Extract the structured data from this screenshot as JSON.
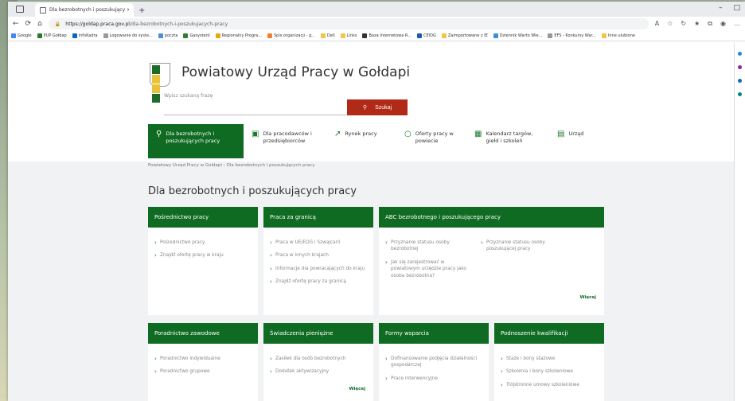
{
  "browser": {
    "tab_title": "Dla bezrobotnych i poszukujący ×",
    "url_domain": "https://goldap.praca.gov.pl",
    "url_path": "/dla-bezrobotnych-i-poszukujacych-pracy",
    "bookmarks": [
      "Google",
      "PUP Gołdap",
      "infoKadra",
      "Logowanie do syste...",
      "poczta",
      "Gasystent",
      "Regionalny Progra...",
      "Spis organizacji - g...",
      "Dell",
      "Links",
      "Baza Internetowa R...",
      "CEIDG",
      "Zaimportowane z IE",
      "Dziennik Warto Wie...",
      "EFS - Konkursy War...",
      "Inne ulubione"
    ]
  },
  "header": {
    "site_title": "Powiatowy Urząd Pracy w Gołdapi",
    "search_placeholder": "Wpisz szukaną frazę",
    "search_button": "Szukaj"
  },
  "nav": [
    {
      "icon": "person-icon",
      "line1": "Dla bezrobotnych i",
      "line2": "poszukujących pracy"
    },
    {
      "icon": "briefcase-icon",
      "line1": "Dla pracodawców i",
      "line2": "przedsiębiorców"
    },
    {
      "icon": "chart-icon",
      "line1": "Rynek pracy",
      "line2": ""
    },
    {
      "icon": "search-icon",
      "line1": "Oferty pracy w",
      "line2": "powiecie"
    },
    {
      "icon": "calendar-icon",
      "line1": "Kalendarz targów,",
      "line2": "giełd i szkoleń"
    },
    {
      "icon": "building-icon",
      "line1": "Urząd",
      "line2": ""
    }
  ],
  "breadcrumb": "Powiatowy Urząd Pracy w Gołdapi  ›  Dla bezrobotnych i poszukujących pracy",
  "page_title": "Dla bezrobotnych i poszukujących pracy",
  "cards": {
    "c1": {
      "title": "Pośrednictwo pracy",
      "items": [
        "Pośrednictwo pracy",
        "Znajdź ofertę pracy w kraju"
      ]
    },
    "c2": {
      "title": "Praca za granicą",
      "items": [
        "Praca w UE/EOG i Szwajcarii",
        "Praca w innych krajach",
        "Informacje dla powracających do kraju",
        "Znajdź ofertę pracy za granicą"
      ]
    },
    "c3": {
      "title": "ABC bezrobotnego i poszukującego pracy",
      "col1": [
        "Przyznanie statusu osoby bezrobotnej",
        "Jak się zarejestrować w powiatowym urzędzie pracy jako osoba bezrobotna?"
      ],
      "col2": [
        "Przyznanie statusu osoby poszukującej pracy"
      ],
      "more": "Więcej"
    },
    "c4": {
      "title": "Poradnictwo zawodowe",
      "items": [
        "Poradnictwo indywidualne",
        "Poradnictwo grupowe"
      ]
    },
    "c5": {
      "title": "Świadczenia pieniężne",
      "items": [
        "Zasiłek dla osób bezrobotnych",
        "Dodatek aktywizacyjny"
      ],
      "more": "Więcej"
    },
    "c6": {
      "title": "Formy wsparcia",
      "items": [
        "Dofinansowanie podjęcia działalności gospodarczej",
        "Prace interwencyjne"
      ]
    },
    "c7": {
      "title": "Podnoszenie kwalifikacji",
      "items": [
        "Staże i bony stażowe",
        "Szkolenia i bony szkoleniowe",
        "Trójstronne umowy szkoleniowe"
      ]
    }
  },
  "colors": {
    "primary_green": "#0f6b22",
    "search_red": "#b12a18"
  }
}
